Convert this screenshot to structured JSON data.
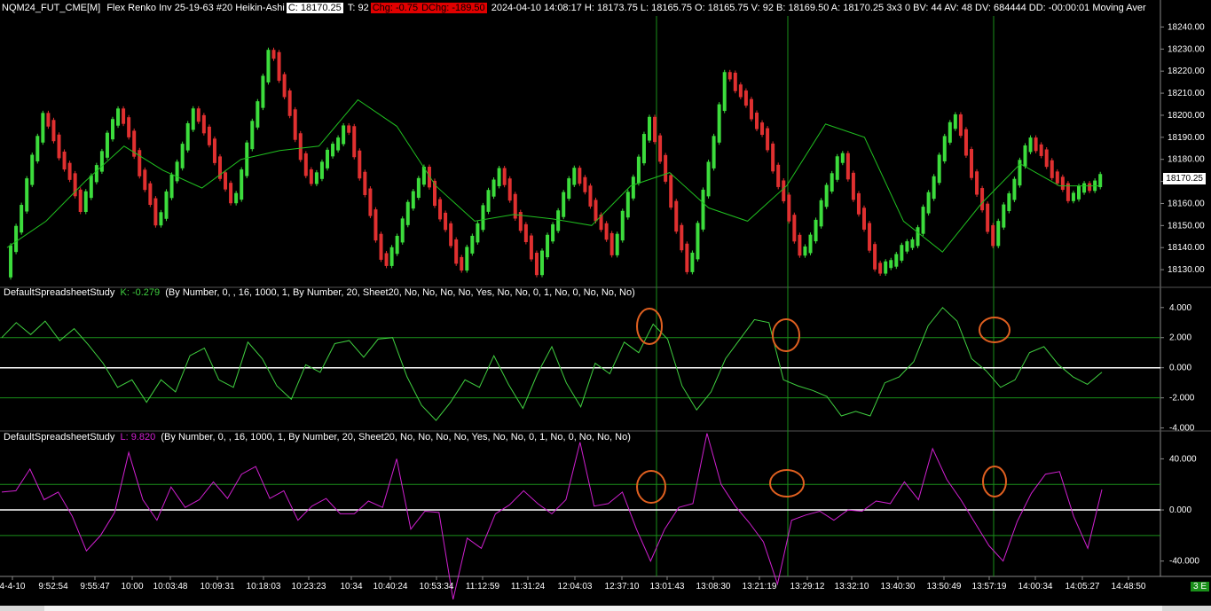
{
  "header": {
    "symbol": "NQM24_FUT_CME[M]",
    "chart_desc": "Flex Renko Inv 25-19-63 #20 Heikin-Ashi",
    "close": "C: 18170.25",
    "ticks": "T: 92",
    "chg": "Chg: -0.75",
    "dchg": "DChg: -189.50",
    "rest": "2024-04-10 14:08:17 H: 18173.75 L: 18165.75 O: 18165.75 V: 92 B: 18169.50 A: 18170.25 3x3 0 BV: 44 AV: 48 DV: 684444 DD: -00:00:01 Moving Aver"
  },
  "study1": {
    "name": "DefaultSpreadsheetStudy",
    "value": "K: -0.279",
    "params": "(By Number, 0, , 16, 1000, 1, By Number, 20, Sheet20, No, No, No, No, Yes, No, No, 0, 1, No, 0, No, No, No)"
  },
  "study2": {
    "name": "DefaultSpreadsheetStudy",
    "value": "L: 9.820",
    "params": "(By Number, 0, , 16, 1000, 1, By Number, 20, Sheet20, No, No, No, No, Yes, No, No, 0, 1, No, 0, No, No, No)"
  },
  "last_price": "18170.25",
  "status_badge": "3 E",
  "colors": {
    "up": "#3cdc3c",
    "down": "#e03030",
    "ma": "#20c020",
    "osc1": "#40d040",
    "osc2": "#d020d0",
    "guide": "#1a8f1a",
    "marker": "#e06020"
  },
  "chart_data": [
    {
      "type": "candlestick",
      "ylim": [
        18122,
        18245
      ],
      "y_ticks": [
        "18240.00",
        "18230.00",
        "18220.00",
        "18210.00",
        "18200.00",
        "18190.00",
        "18180.00",
        "18170.00",
        "18160.00",
        "18150.00",
        "18140.00",
        "18130.00"
      ],
      "y_tick_values": [
        18240,
        18230,
        18220,
        18210,
        18200,
        18190,
        18180,
        18170,
        18160,
        18150,
        18140,
        18130
      ],
      "x_ticks": [
        "4-4-10",
        "9:52:54",
        "9:55:47",
        "10:00",
        "10:03:48",
        "10:09:31",
        "10:18:03",
        "10:23:23",
        "10:34",
        "10:40:24",
        "10:53:34",
        "11:12:59",
        "11:31:24",
        "12:04:03",
        "12:37:10",
        "13:01:43",
        "13:08:30",
        "13:21:19",
        "13:29:12",
        "13:32:10",
        "13:40:30",
        "13:50:49",
        "13:57:19",
        "14:00:34",
        "14:05:27",
        "14:48:50"
      ],
      "swing_points": [
        18128,
        18201,
        18158,
        18204,
        18150,
        18204,
        18158,
        18232,
        18168,
        18196,
        18130,
        18176,
        18130,
        18176,
        18130,
        18176,
        18138,
        18199,
        18127,
        18221,
        18190,
        18134,
        18184,
        18128,
        18145,
        18202,
        18142,
        18190,
        18163,
        18172
      ],
      "ma_points": [
        18140,
        18152,
        18170,
        18186,
        18175,
        18167,
        18180,
        18184,
        18186,
        18207,
        18195,
        18168,
        18152,
        18155,
        18153,
        18150,
        18168,
        18174,
        18158,
        18152,
        18168,
        18196,
        18190,
        18152,
        18138,
        18160,
        18178,
        18168,
        18168
      ],
      "last_price": 18170.25
    },
    {
      "type": "line",
      "series_label": "K",
      "ylim": [
        -4.2,
        4.4
      ],
      "y_ticks": [
        "4.000",
        "2.000",
        "0.000",
        "-2.000",
        "-4.000"
      ],
      "y_tick_values": [
        4,
        2,
        0,
        -2,
        -4
      ],
      "guides": [
        2,
        0,
        -2
      ],
      "values": [
        2.0,
        3.0,
        2.2,
        3.1,
        1.8,
        2.6,
        1.5,
        0.3,
        -1.3,
        -0.8,
        -2.3,
        -0.8,
        -1.6,
        0.8,
        1.3,
        -0.8,
        -1.3,
        1.7,
        0.6,
        -1.2,
        -2.1,
        0.2,
        -0.3,
        1.6,
        1.8,
        0.7,
        1.9,
        2.0,
        -0.6,
        -2.5,
        -3.5,
        -2.3,
        -0.8,
        -1.3,
        0.8,
        -1.1,
        -2.7,
        -0.4,
        1.4,
        -1.0,
        -2.6,
        0.3,
        -0.4,
        1.7,
        1.0,
        2.9,
        1.9,
        -1.2,
        -2.8,
        -1.6,
        0.6,
        1.9,
        3.2,
        3.0,
        -0.8,
        -1.2,
        -1.5,
        -1.9,
        -3.2,
        -2.9,
        -3.2,
        -1.0,
        -0.6,
        0.4,
        2.8,
        4.0,
        3.1,
        0.6,
        -0.2,
        -1.3,
        -0.8,
        1.0,
        1.4,
        0.2,
        -0.6,
        -1.1,
        -0.3
      ]
    },
    {
      "type": "line",
      "series_label": "L",
      "ylim": [
        -52,
        50
      ],
      "y_ticks": [
        "40.000",
        "0.000",
        "-40.000"
      ],
      "y_tick_values": [
        40,
        0,
        -40
      ],
      "guides": [
        20,
        0,
        -20
      ],
      "values": [
        14,
        15,
        32,
        8,
        14,
        -5,
        -32,
        -20,
        -2,
        45,
        8,
        -8,
        18,
        2,
        8,
        22,
        9,
        28,
        34,
        9,
        15,
        -8,
        3,
        9,
        -3,
        -3,
        7,
        2,
        40,
        -15,
        -1,
        -2,
        -70,
        -22,
        -30,
        -3,
        4,
        15,
        5,
        -3,
        8,
        53,
        3,
        5,
        14,
        -15,
        -40,
        -15,
        2,
        5,
        60,
        20,
        3,
        -10,
        -25,
        -58,
        -8,
        -4,
        -1,
        -8,
        0,
        -1,
        7,
        5,
        22,
        8,
        48,
        24,
        8,
        -10,
        -28,
        -40,
        -9,
        13,
        28,
        30,
        -5,
        -30,
        16
      ]
    }
  ]
}
